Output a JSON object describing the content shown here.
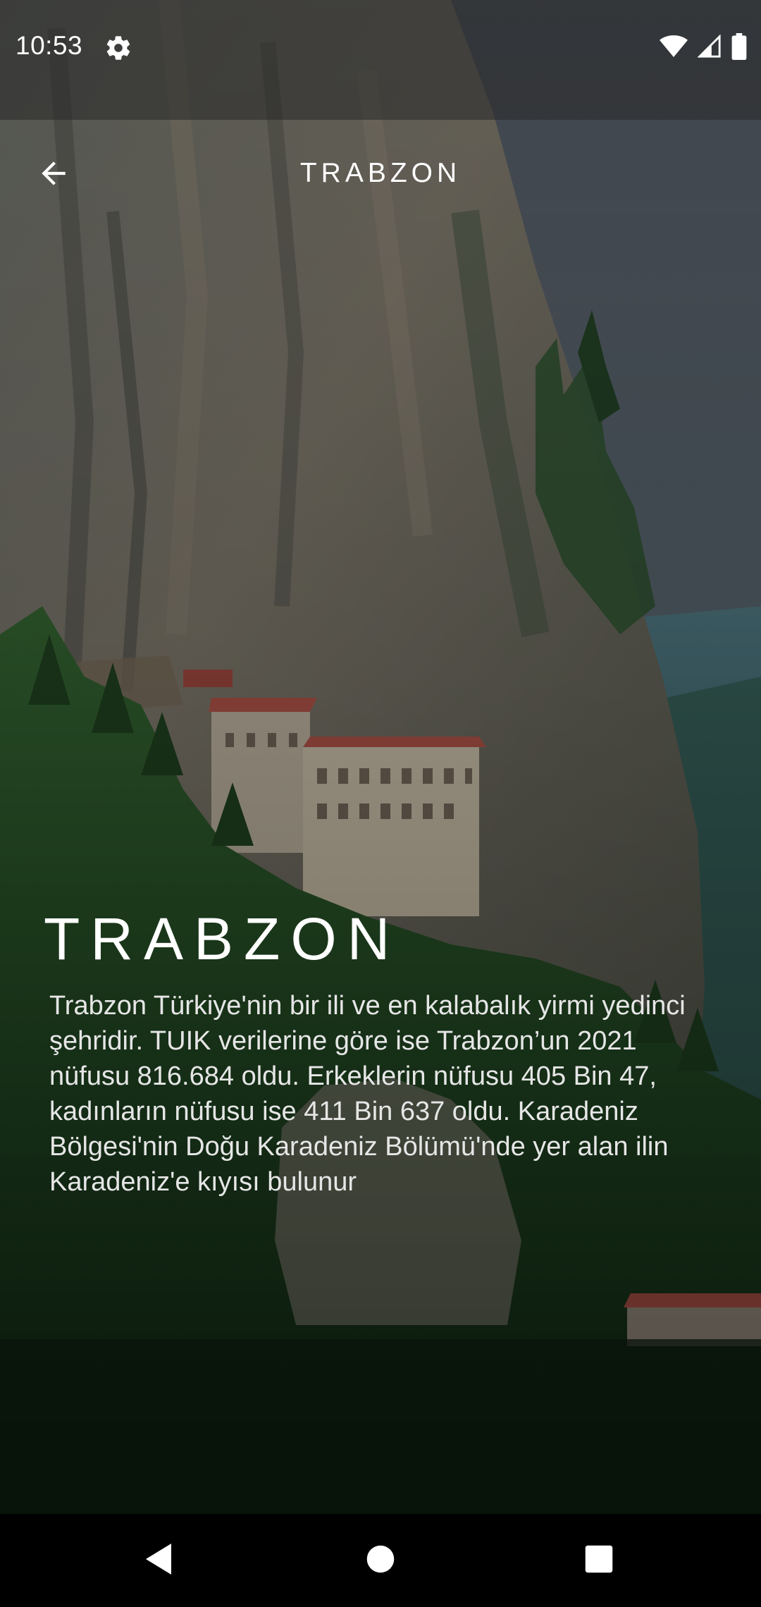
{
  "status_bar": {
    "time": "10:53",
    "icons": [
      "gear-icon",
      "wifi-icon",
      "signal-icon",
      "battery-icon"
    ]
  },
  "app_bar": {
    "title": "TRABZON",
    "back_icon": "arrow-left-icon"
  },
  "content": {
    "title": "TRABZON",
    "description": "Trabzon Türkiye'nin bir ili ve en kalabalık yirmi yedinci şehridir. TUIK verilerine göre ise Trabzon’un 2021 nüfusu 816.684 oldu. Erkeklerin nüfusu 405 Bin 47, kadınların nüfusu ise 411 Bin 637 oldu. Karadeniz Bölgesi'nin Doğu Karadeniz Bölümü'nde yer alan ilin Karadeniz'e kıyısı bulunur"
  },
  "nav_bar": {
    "icons": [
      "back-triangle-icon",
      "home-circle-icon",
      "recents-square-icon"
    ]
  },
  "colors": {
    "text_primary": "#ffffff",
    "text_secondary": "#e6e6e6",
    "nav_background": "#000000"
  }
}
